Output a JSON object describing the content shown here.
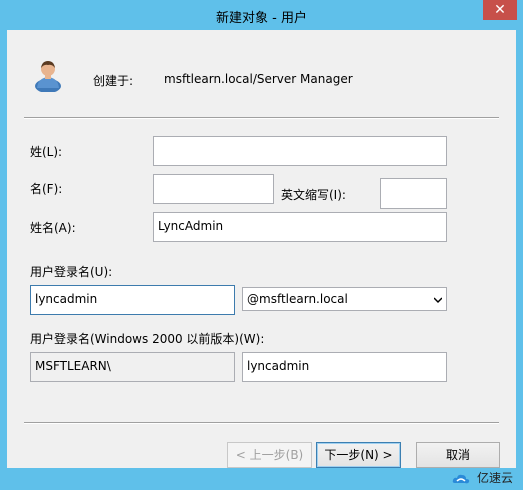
{
  "window": {
    "title": "新建对象 - 用户",
    "close_glyph": "✕"
  },
  "header": {
    "created_in_label": "创建于:",
    "created_in_value": "msftlearn.local/Server Manager",
    "icon": "user-icon"
  },
  "form": {
    "last_name_label": "姓(L):",
    "last_name_value": "",
    "first_name_label": "名(F):",
    "first_name_value": "",
    "initials_label": "英文缩写(I):",
    "initials_value": "",
    "full_name_label": "姓名(A):",
    "full_name_value": "LyncAdmin",
    "logon_name_label": "用户登录名(U):",
    "logon_name_value": "lyncadmin",
    "domain_selected": "@msftlearn.local",
    "legacy_logon_label": "用户登录名(Windows 2000 以前版本)(W):",
    "legacy_domain_value": "MSFTLEARN\\",
    "legacy_logon_value": "lyncadmin"
  },
  "buttons": {
    "back": "< 上一步(B)",
    "next": "下一步(N) >",
    "cancel": "取消"
  },
  "watermark": {
    "text": "亿速云"
  },
  "colors": {
    "frame": "#5fc0ea",
    "dialog": "#f0f0f0",
    "close_button": "#c7504a",
    "focus_border": "#3d7bad"
  }
}
